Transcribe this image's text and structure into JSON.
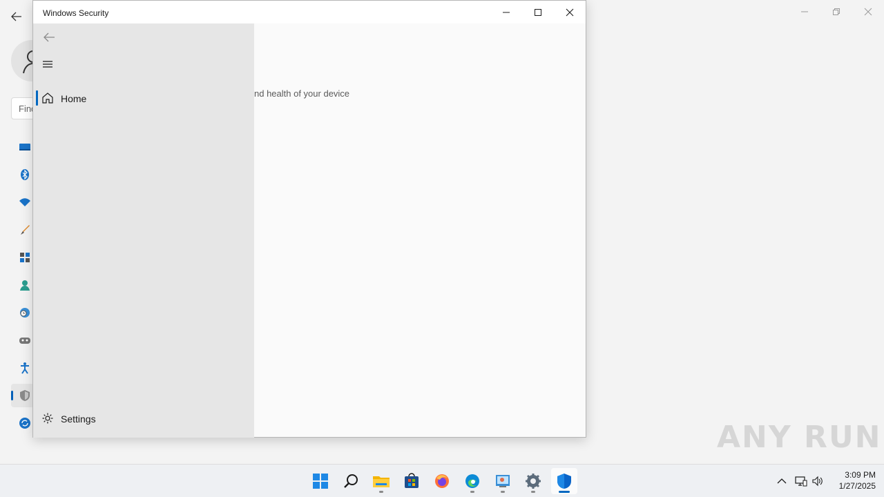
{
  "background_window": {
    "search_placeholder": "Find",
    "nav_icons": [
      "display-icon",
      "bluetooth-icon",
      "wifi-icon",
      "personalization-icon",
      "apps-icon",
      "accounts-icon",
      "time-language-icon",
      "gaming-icon",
      "accessibility-icon",
      "privacy-security-icon",
      "windows-update-icon"
    ],
    "active_nav": "privacy-security-icon"
  },
  "security_window": {
    "title": "Windows Security",
    "content_partial_text": "nd health of your device",
    "nav": {
      "home_label": "Home",
      "settings_label": "Settings"
    }
  },
  "watermark": "ANY RUN",
  "taskbar": {
    "apps": [
      "start-icon",
      "search-icon",
      "file-explorer-icon",
      "store-icon",
      "firefox-icon",
      "edge-icon",
      "control-panel-icon",
      "settings-icon",
      "windows-security-icon"
    ],
    "active_app": "windows-security-icon"
  },
  "clock": {
    "time": "3:09 PM",
    "date": "1/27/2025"
  },
  "colors": {
    "accent": "#0067c0",
    "pane_bg": "#e6e6e6",
    "taskbar_bg": "#eef0f3"
  }
}
